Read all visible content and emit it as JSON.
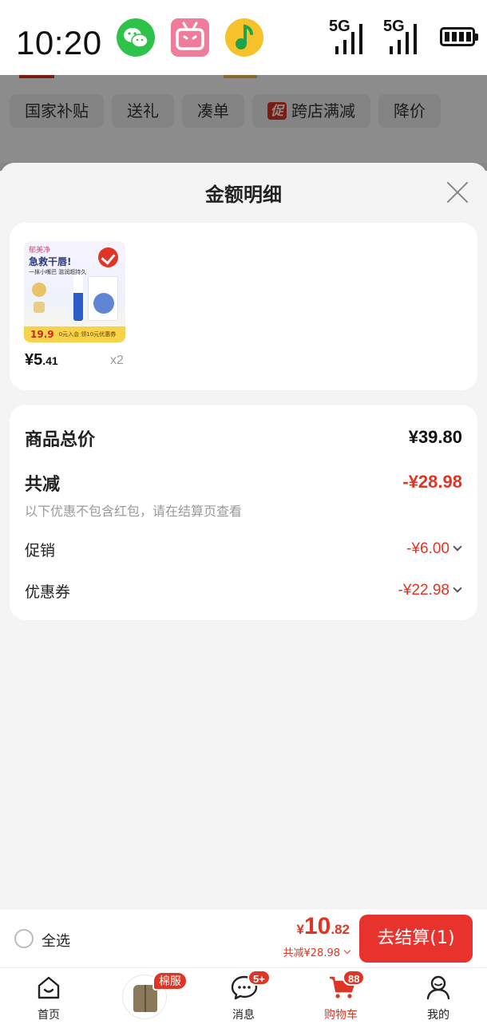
{
  "status_bar": {
    "time": "10:20",
    "apps": [
      "wechat-icon",
      "bilibili-icon",
      "qq-music-icon"
    ],
    "signal_label_1": "5G",
    "signal_label_2": "5G"
  },
  "filters": [
    {
      "label": "国家补贴"
    },
    {
      "label": "送礼"
    },
    {
      "label": "凑单"
    },
    {
      "label": "跨店满减",
      "badge": "促"
    },
    {
      "label": "降价"
    }
  ],
  "sheet": {
    "title": "金额明细",
    "product": {
      "image_brand": "郁美净",
      "image_headline": "急救干唇!",
      "image_sub": "一抹小嘴巴 滋润超持久",
      "image_price": "19.9",
      "image_promo": "0元入会 领10元优惠券",
      "price_symbol": "¥",
      "price_int": "5",
      "price_dec": ".41",
      "quantity": "x2"
    },
    "details": {
      "total_label": "商品总价",
      "total_value": "¥39.80",
      "discount_label": "共减",
      "discount_value": "-¥28.98",
      "note": "以下优惠不包含红包，请在结算页查看",
      "promo_label": "促销",
      "promo_value": "-¥6.00",
      "coupon_label": "优惠券",
      "coupon_value": "-¥22.98"
    }
  },
  "checkout": {
    "select_all": "全选",
    "price_symbol": "¥",
    "price_int": "10",
    "price_dec": ".82",
    "saved": "共减¥28.98",
    "pay_button": "去结算(1)"
  },
  "nav": {
    "home": "首页",
    "promo_tag": "棉服",
    "messages": "消息",
    "messages_badge": "5+",
    "cart": "购物车",
    "cart_badge": "88",
    "mine": "我的"
  },
  "colors": {
    "accent": "#e03424",
    "pay_button": "#e8322d"
  }
}
